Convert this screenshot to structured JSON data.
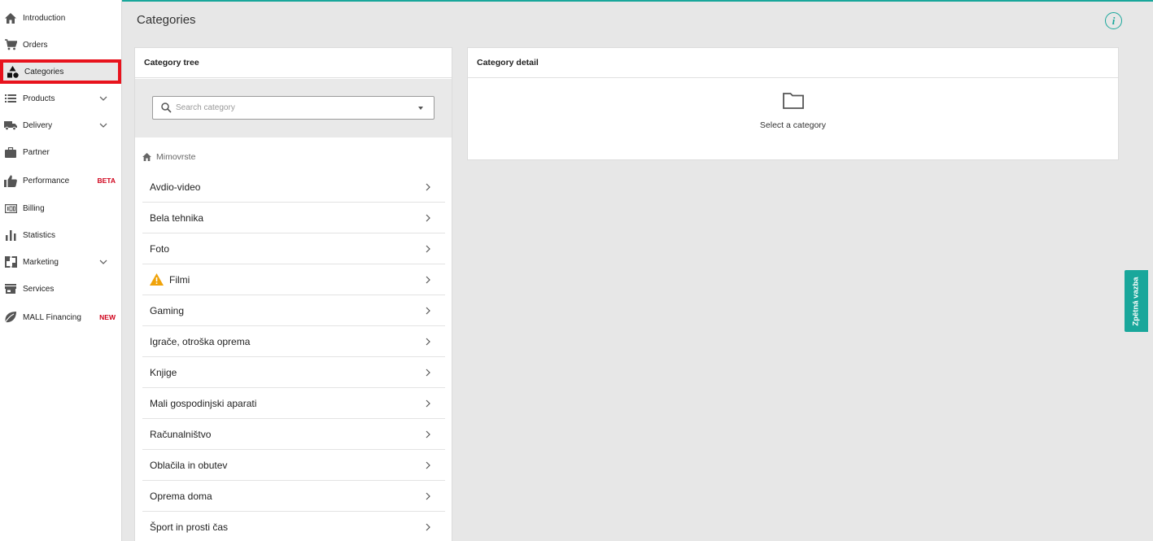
{
  "sidebar": {
    "items": [
      {
        "label": "Introduction",
        "icon": "home-icon"
      },
      {
        "label": "Orders",
        "icon": "cart-icon"
      },
      {
        "label": "Categories",
        "icon": "shapes-icon"
      },
      {
        "label": "Products",
        "icon": "list-icon"
      },
      {
        "label": "Delivery",
        "icon": "truck-icon"
      },
      {
        "label": "Partner",
        "icon": "briefcase-icon"
      },
      {
        "label": "Performance",
        "icon": "thumbs-up-icon",
        "badge": "BETA"
      },
      {
        "label": "Billing",
        "icon": "billing-icon"
      },
      {
        "label": "Statistics",
        "icon": "bar-chart-icon"
      },
      {
        "label": "Marketing",
        "icon": "marketing-icon"
      },
      {
        "label": "Services",
        "icon": "store-icon"
      },
      {
        "label": "MALL Financing",
        "icon": "leaf-icon",
        "badge": "NEW"
      }
    ]
  },
  "header": {
    "title": "Categories"
  },
  "tree": {
    "title": "Category tree",
    "search_placeholder": "Search category",
    "breadcrumb": "Mimovrste",
    "categories": [
      {
        "name": "Avdio-video"
      },
      {
        "name": "Bela tehnika"
      },
      {
        "name": "Foto"
      },
      {
        "name": "Filmi",
        "warning": true
      },
      {
        "name": "Gaming"
      },
      {
        "name": "Igrače, otroška oprema"
      },
      {
        "name": "Knjige"
      },
      {
        "name": "Mali gospodinjski aparati"
      },
      {
        "name": "Računalništvo"
      },
      {
        "name": "Oblačila in obutev"
      },
      {
        "name": "Oprema doma"
      },
      {
        "name": "Šport in prosti čas"
      }
    ]
  },
  "detail": {
    "title": "Category detail",
    "empty_text": "Select a category"
  },
  "feedback": {
    "label": "Zpětná vazba"
  },
  "colors": {
    "accent": "#19a79b",
    "highlight": "#e8131d",
    "badge": "#d0021b",
    "warning": "#f0a30a"
  }
}
